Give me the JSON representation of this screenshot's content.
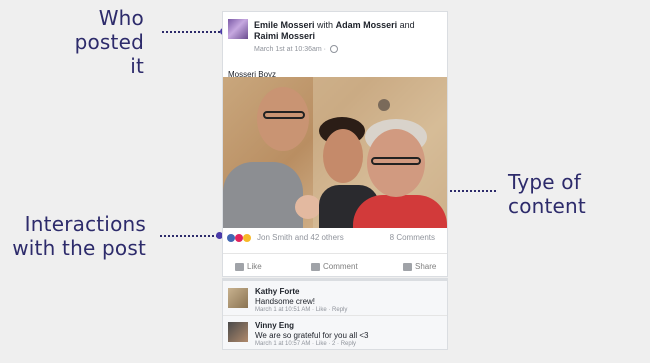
{
  "annotations": {
    "who_posted": [
      "Who",
      "posted it"
    ],
    "type_of_content": [
      "Type of",
      "content"
    ],
    "interactions": [
      "Interactions",
      "with the post"
    ]
  },
  "post": {
    "author": "Emile Mosseri",
    "with_text": "with",
    "tag1": "Adam Mosseri",
    "and_text": "and",
    "tag2": "Raimi Mosseri",
    "timestamp": "March 1st at 10:36am ·",
    "caption": "Mosseri Boyz",
    "reactions_text": "Jon Smith and 42 others",
    "comments_count": "8 Comments",
    "actions": {
      "like": "Like",
      "comment": "Comment",
      "share": "Share"
    }
  },
  "comments": [
    {
      "name": "Kathy Forte",
      "text": "Handsome crew!",
      "meta": "March 1 at 10:51 AM · Like · Reply"
    },
    {
      "name": "Vinny Eng",
      "text": "We are so grateful for you all <3",
      "meta": "March 1 at 10:57 AM · Like · 2 · Reply"
    }
  ],
  "colors": {
    "annotation": "#2d2b6b",
    "dot": "#4a3aa8",
    "like": "#4267b2",
    "love": "#e0245e",
    "haha": "#f7b928"
  }
}
